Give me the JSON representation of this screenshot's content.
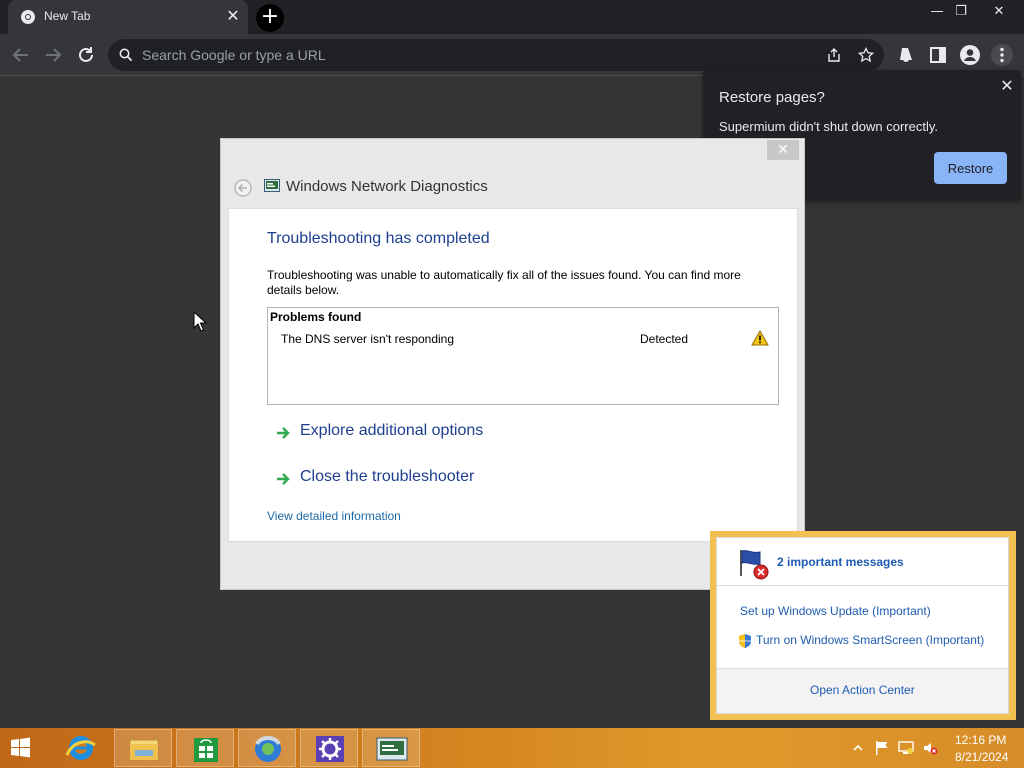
{
  "browser": {
    "tab_title": "New Tab",
    "tab_close": "✕",
    "omnibox_placeholder": "Search Google or type a URL",
    "window_controls": {
      "minimize": "—",
      "restore": "❐",
      "close": "✕"
    }
  },
  "restore_popup": {
    "title": "Restore pages?",
    "message": "Supermium didn't shut down correctly.",
    "button_label": "Restore",
    "close": "✕",
    "accent_color": "#8ab4f8"
  },
  "dialog": {
    "close": "✕",
    "title": "Windows Network Diagnostics",
    "heading": "Troubleshooting has completed",
    "description": "Troubleshooting was unable to automatically fix all of the issues found. You can find more details below.",
    "problems_header": "Problems found",
    "problems": [
      {
        "name": "The DNS server isn't responding",
        "status": "Detected",
        "icon": "warning-icon"
      }
    ],
    "options": [
      {
        "label": "Explore additional options",
        "icon": "green-arrow-icon"
      },
      {
        "label": "Close the troubleshooter",
        "icon": "green-arrow-icon"
      }
    ],
    "detail_link": "View detailed information",
    "heading_color": "#1e3f8f"
  },
  "action_center": {
    "heading": "2 important messages",
    "items": [
      "Set up Windows Update (Important)",
      "Turn on Windows SmartScreen (Important)"
    ],
    "footer_link": "Open Action Center",
    "border_color": "#f1c050"
  },
  "taskbar": {
    "apps": [
      "start-icon",
      "internet-explorer-icon",
      "file-explorer-icon",
      "store-icon",
      "chrome-icon",
      "control-panel-icon",
      "network-diagnostics-icon"
    ],
    "time": "12:16 PM",
    "date": "8/21/2024",
    "color": "#cf7d1c"
  }
}
